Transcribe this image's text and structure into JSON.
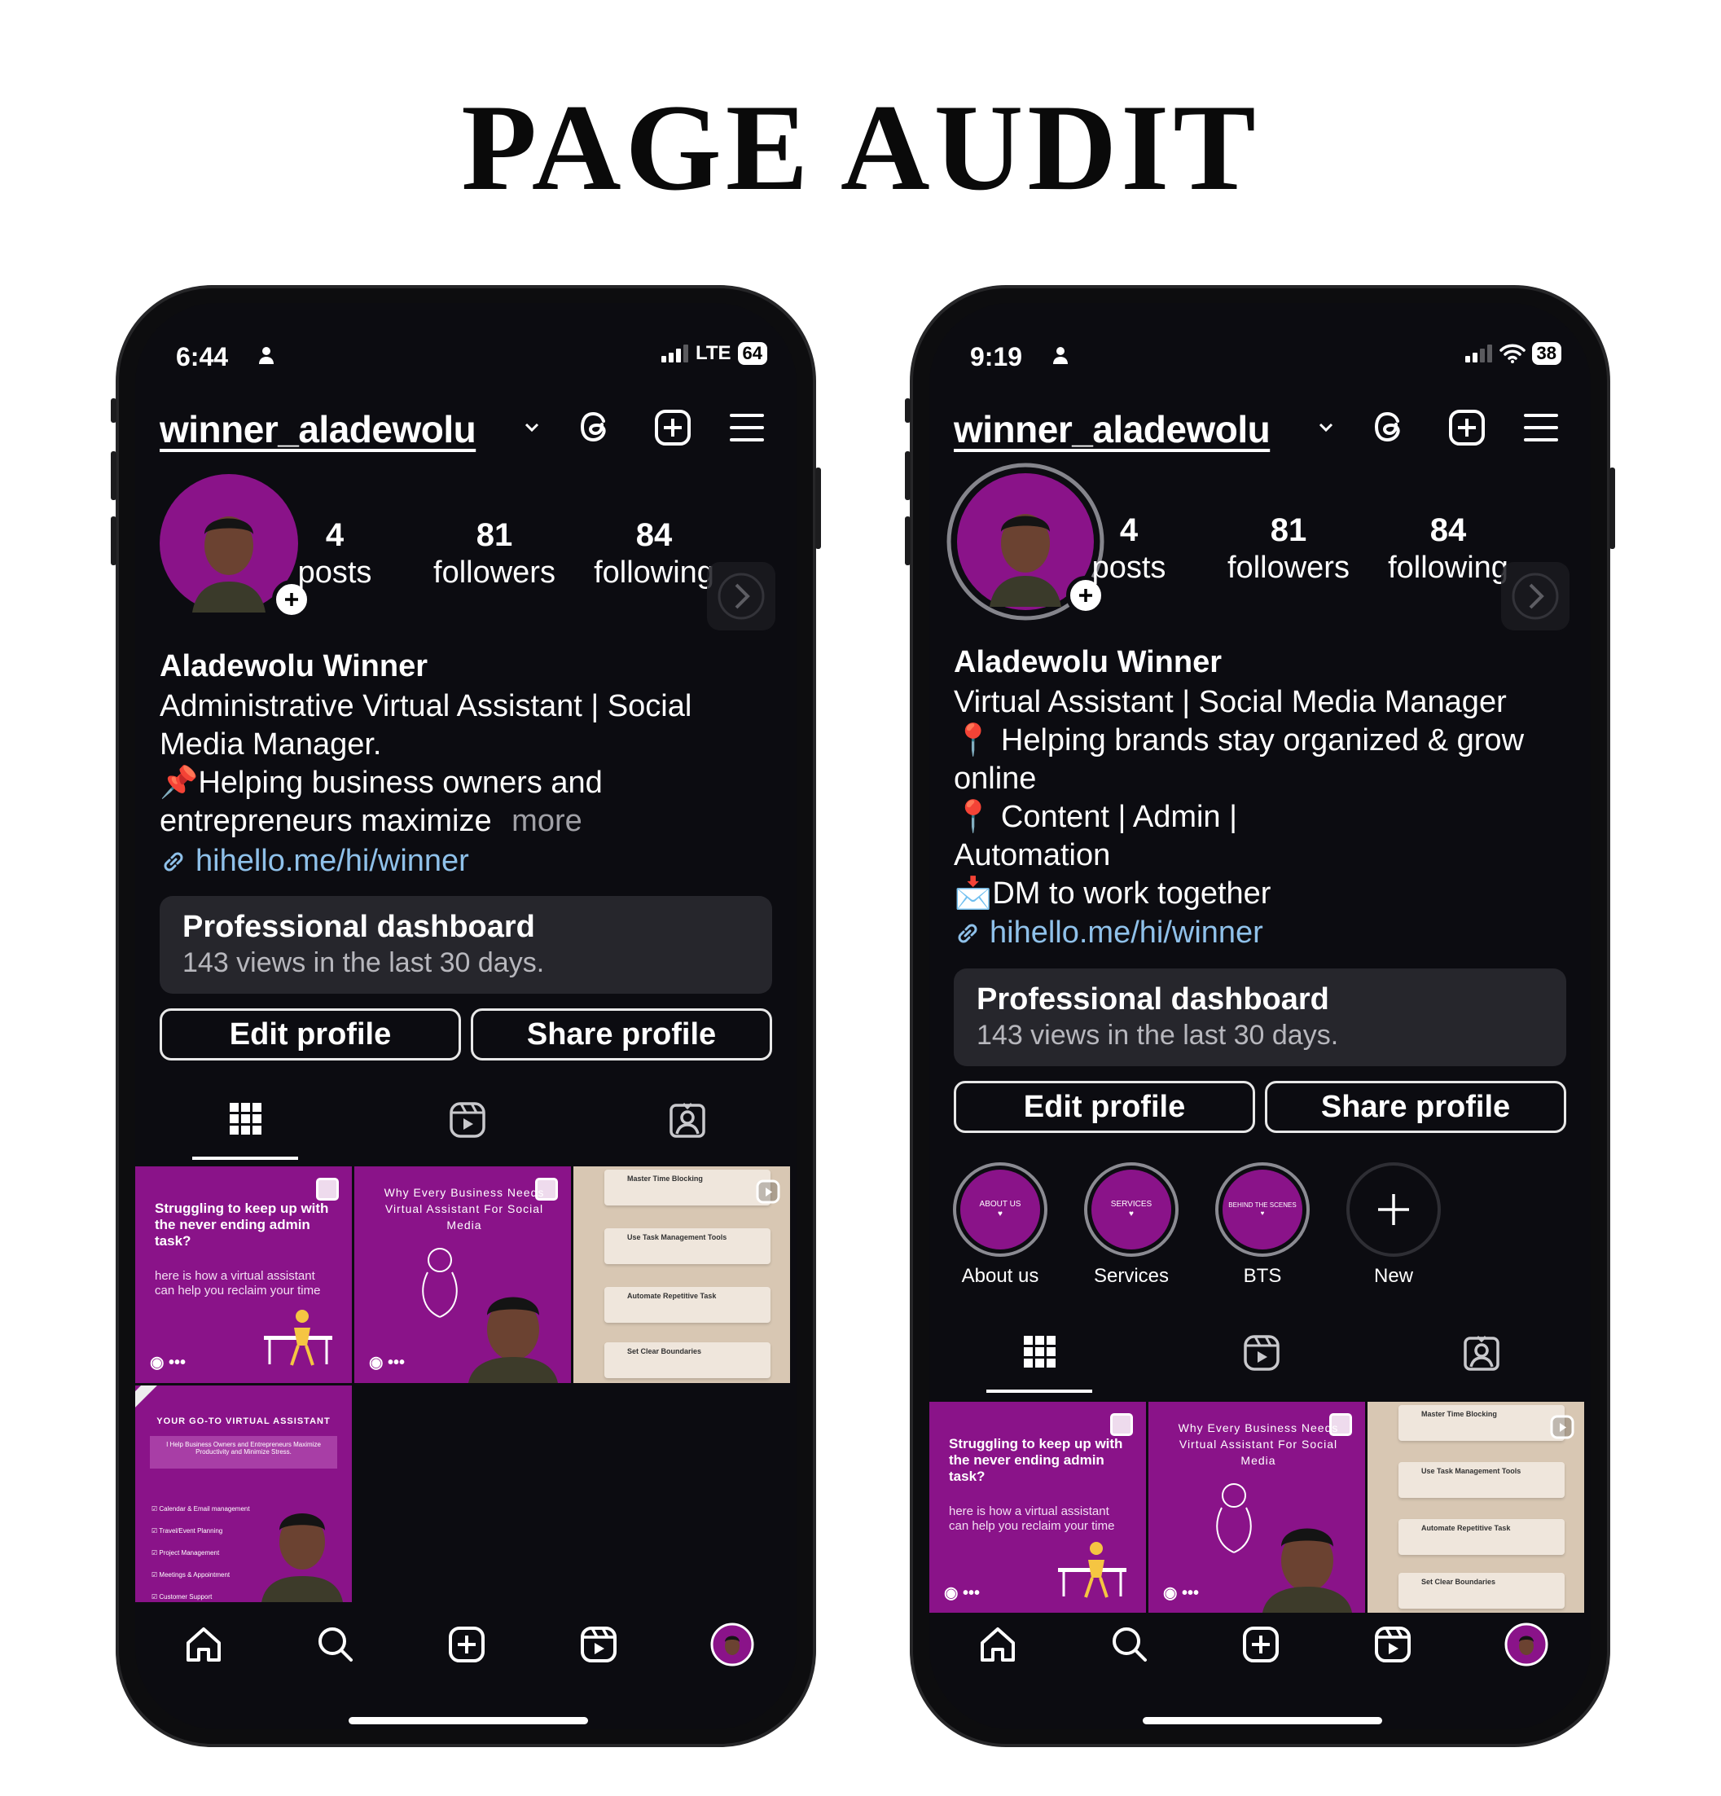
{
  "title": "PAGE AUDIT",
  "phones": [
    {
      "status": {
        "time": "6:44",
        "network": "LTE",
        "battery": "64"
      },
      "profile": {
        "username": "winner_aladewolu",
        "stats": [
          {
            "num": "4",
            "label": "posts"
          },
          {
            "num": "81",
            "label": "followers"
          },
          {
            "num": "84",
            "label": "following"
          }
        ],
        "name": "Aladewolu Winner",
        "bio": [
          "Administrative Virtual Assistant | Social",
          "Media Manager.",
          "📌Helping business owners and",
          "entrepreneurs maximize"
        ],
        "more": "more",
        "link": "hihello.me/hi/winner"
      },
      "dashboard": {
        "title": "Professional dashboard",
        "subtitle": "143 views in the last 30 days."
      },
      "buttons": {
        "edit": "Edit profile",
        "share": "Share profile"
      },
      "posts": {
        "p1_title": "Struggling to keep up with the never ending admin task?",
        "p1_sub": "here is how a virtual assistant can help you reclaim your time",
        "p2_title": "Why Every Business Needs Virtual Assistant For Social Media",
        "p3_steps": [
          "Master Time Blocking",
          "Use Task Management Tools",
          "Automate Repetitive Task",
          "Set Clear Boundaries"
        ],
        "p4_title": "YOUR GO-TO VIRTUAL ASSISTANT",
        "p4_sub": "I Help Business Owners and Entrepreneurs Maximize Productivity and Minimize Stress.",
        "p4_list": [
          "Calendar & Email management",
          "Travel/Event Planning",
          "Project Management",
          "Meetings & Appointment",
          "Customer Support"
        ]
      }
    },
    {
      "status": {
        "time": "9:19",
        "battery": "38"
      },
      "profile": {
        "username": "winner_aladewolu",
        "stats": [
          {
            "num": "4",
            "label": "posts"
          },
          {
            "num": "81",
            "label": "followers"
          },
          {
            "num": "84",
            "label": "following"
          }
        ],
        "name": "Aladewolu Winner",
        "bio": [
          "Virtual Assistant | Social Media Manager",
          "📍 Helping brands stay organized & grow",
          "online",
          "📍 Content | Admin |",
          "Automation",
          "📩DM to work together"
        ],
        "link": "hihello.me/hi/winner"
      },
      "dashboard": {
        "title": "Professional dashboard",
        "subtitle": "143 views in the last 30 days."
      },
      "buttons": {
        "edit": "Edit profile",
        "share": "Share profile"
      },
      "highlights": [
        {
          "label": "About us",
          "ring": "ABOUT US"
        },
        {
          "label": "Services",
          "ring": "SERVICES"
        },
        {
          "label": "BTS",
          "ring": "BEHIND THE SCENES"
        },
        {
          "label": "New"
        }
      ],
      "posts": {
        "p1_title": "Struggling to keep up with the never ending admin task?",
        "p1_sub": "here is how a virtual assistant can help you reclaim your time",
        "p2_title": "Why Every Business Needs Virtual Assistant For Social Media",
        "p3_steps": [
          "Master Time Blocking",
          "Use Task Management Tools",
          "Automate Repetitive Task",
          "Set Clear Boundaries"
        ]
      }
    }
  ],
  "icons": [
    "person-icon",
    "signal-icon",
    "wifi-icon",
    "chevron-down-icon",
    "threads-icon",
    "plus-square-icon",
    "menu-icon",
    "chevron-right-icon",
    "link-icon",
    "grid-icon",
    "reels-icon",
    "tagged-icon",
    "home-icon",
    "search-icon",
    "create-icon",
    "reels-nav-icon"
  ],
  "colors": {
    "brand_purple": "#8a1389",
    "screen_bg": "#0c0c11",
    "link": "#8fc1ea",
    "card": "#26262c"
  }
}
